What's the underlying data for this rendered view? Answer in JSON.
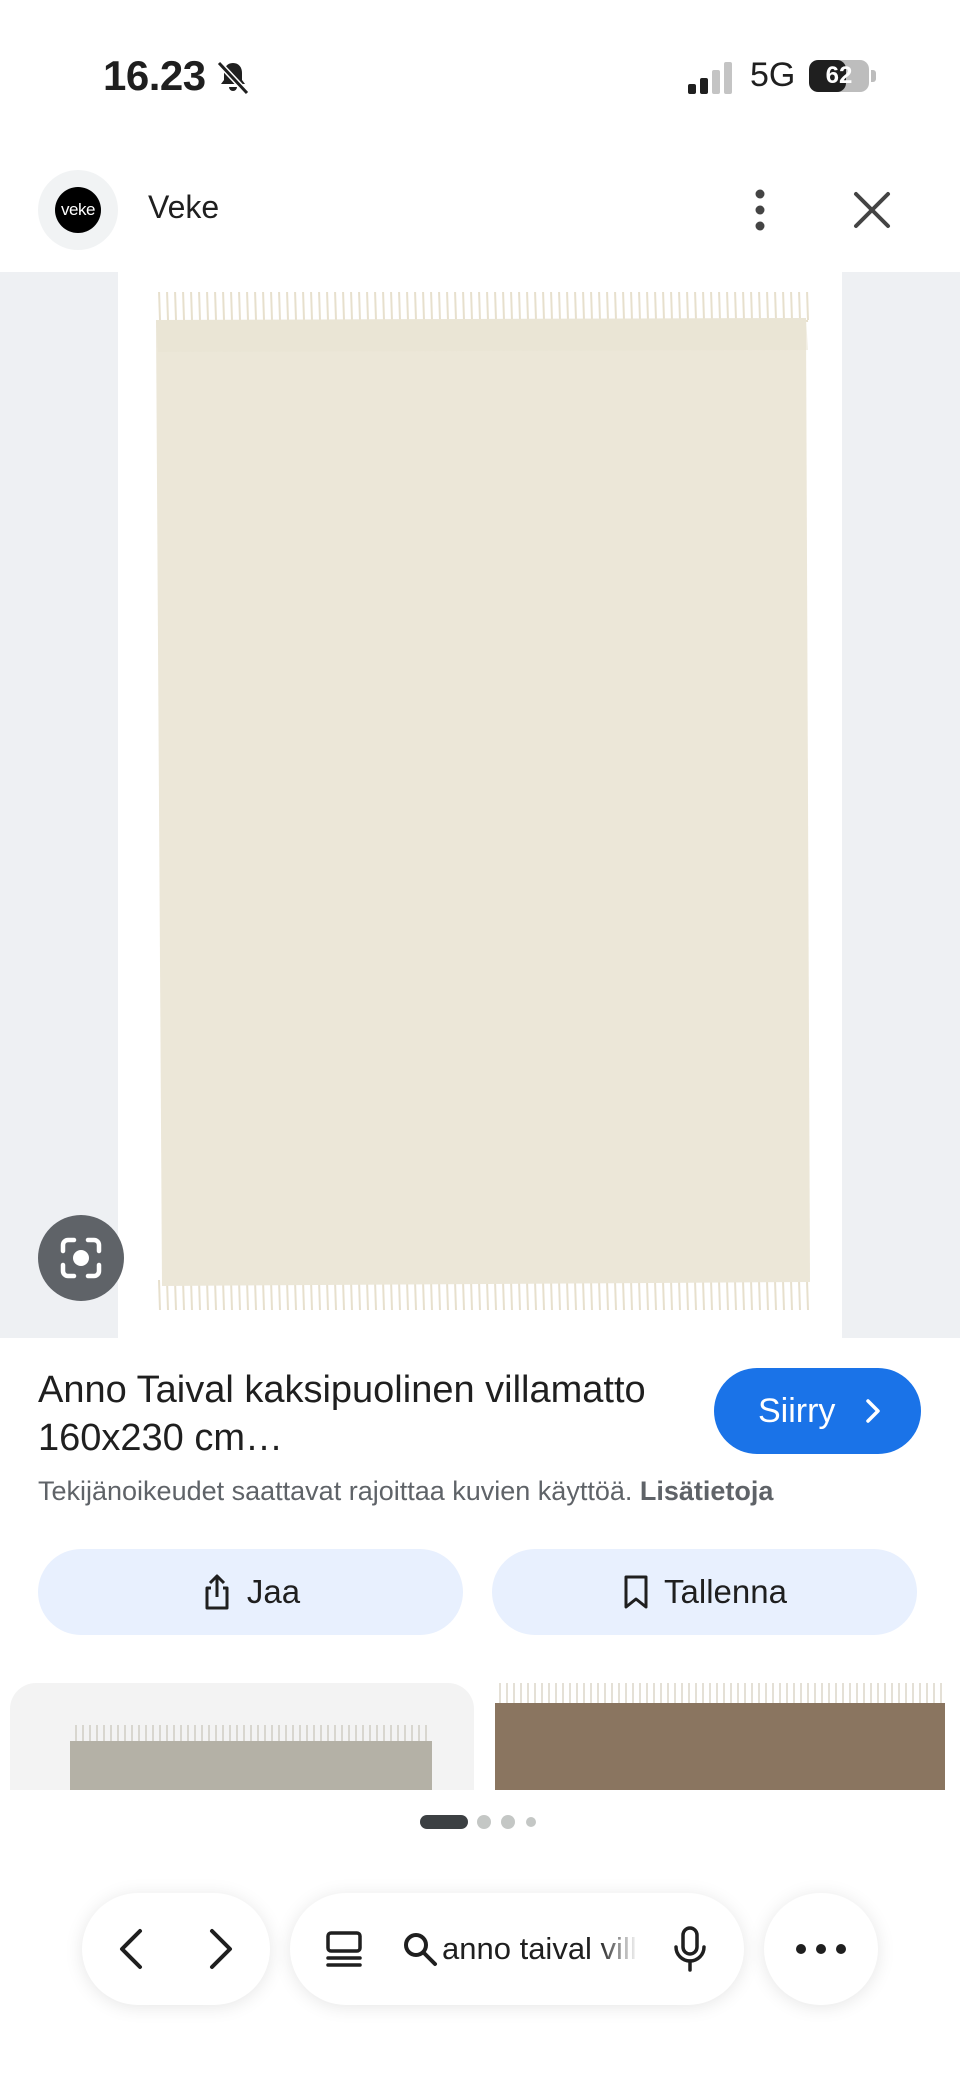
{
  "status_bar": {
    "time": "16.23",
    "network": "5G",
    "battery_percent": "62",
    "battery_level": 0.62
  },
  "header": {
    "logo_text": "veke",
    "site_name": "Veke"
  },
  "result": {
    "title": "Anno Taival kaksipuolinen villamatto 160x230 cm…",
    "visit_label": "Siirry",
    "copyright_notice": "Tekijänoikeudet saattavat rajoittaa kuvien käyttöä.",
    "more_info_link": "Lisätietoja"
  },
  "actions": {
    "share_label": "Jaa",
    "save_label": "Tallenna"
  },
  "pagination": {
    "current": 1,
    "total": 4
  },
  "bottom_bar": {
    "search_query": "anno taival villamatto"
  },
  "colors": {
    "accent": "#1a73e8",
    "pill_background": "#e8f0fe",
    "rug_cream": "#ece7d8",
    "rug_grey": "#b4b1a6",
    "rug_brown": "#8a7560"
  }
}
